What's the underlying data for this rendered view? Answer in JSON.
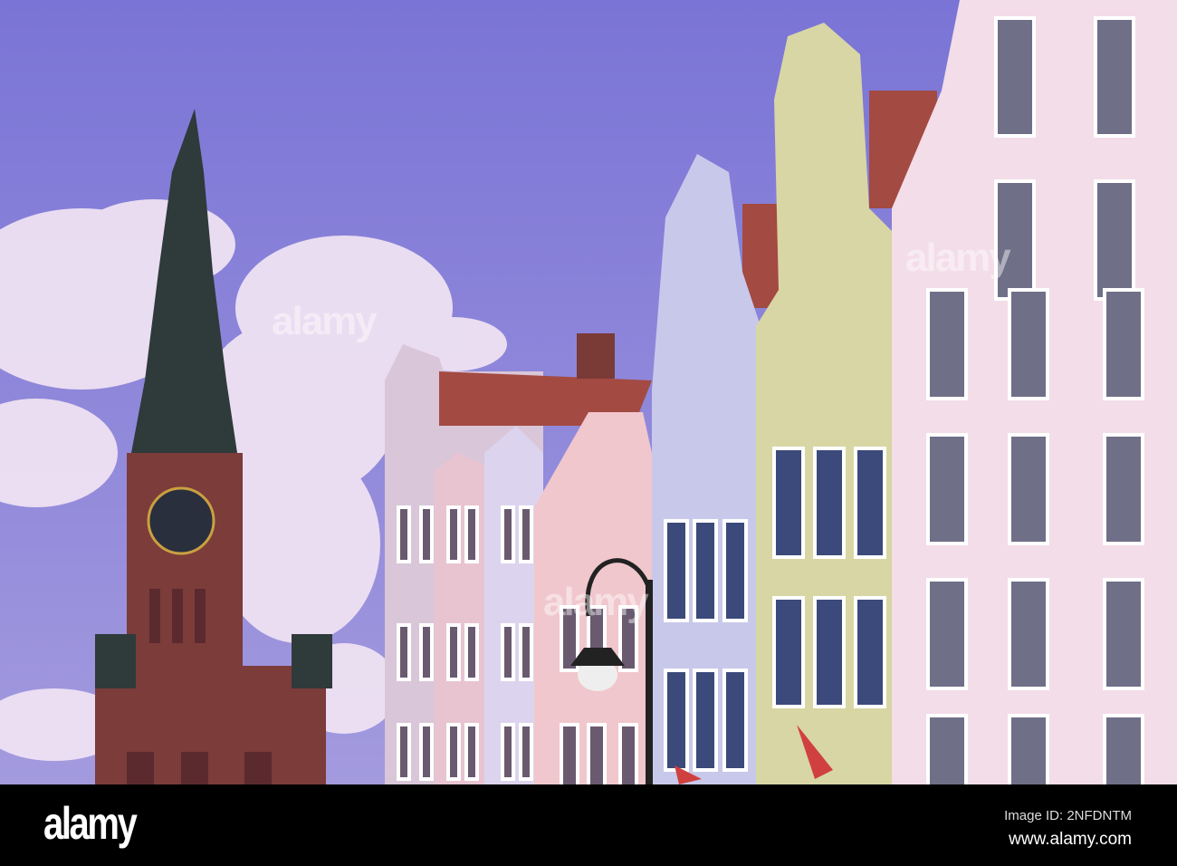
{
  "photo": {
    "subject": "Gdansk Main Town Hall tower and colourful gabled townhouses",
    "colors": {
      "sky_top": "#7a74d6",
      "sky_bottom": "#a39ade",
      "brick": "#7b3c3a",
      "roof": "#a34a42"
    }
  },
  "watermark": {
    "text": "alamy"
  },
  "footer": {
    "logo": "alamy",
    "image_id": "Image ID: 2NFDNTM",
    "site": "www.alamy.com"
  }
}
